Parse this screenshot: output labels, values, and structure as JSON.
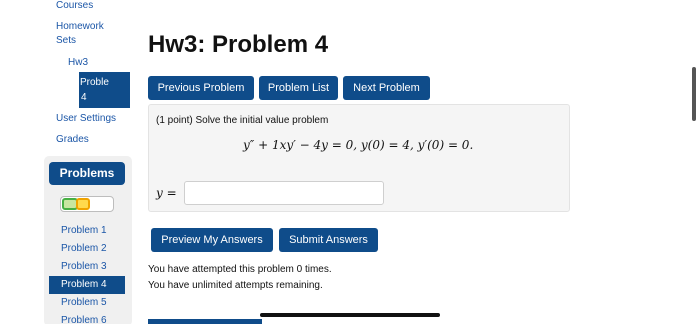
{
  "nav": {
    "courses": "Courses",
    "homework_sets": "Homework Sets",
    "set": "Hw3",
    "problem_line1": "Proble",
    "problem_line2": "4",
    "user_settings": "User Settings",
    "grades": "Grades"
  },
  "problems_panel": {
    "title": "Problems",
    "progress": {
      "correct_fraction": 0.25,
      "partial_fraction": 0.2
    },
    "items": [
      {
        "label": "Problem 1"
      },
      {
        "label": "Problem 2"
      },
      {
        "label": "Problem 3"
      },
      {
        "label": "Problem 4"
      },
      {
        "label": "Problem 5"
      },
      {
        "label": "Problem 6"
      }
    ],
    "active_index": 3
  },
  "page": {
    "title": "Hw3: Problem 4"
  },
  "toolbar": {
    "prev": "Previous Problem",
    "list": "Problem List",
    "next": "Next Problem"
  },
  "problem": {
    "points": "(1 point) Solve the initial value problem",
    "equation": "y″ + 1xy′ − 4y = 0,  y(0) = 4,  y′(0) = 0.",
    "answer_label": "y =",
    "answer_value": ""
  },
  "actions": {
    "preview": "Preview My Answers",
    "submit": "Submit Answers"
  },
  "status": {
    "attempts": "You have attempted this problem 0 times.",
    "remaining": "You have unlimited attempts remaining."
  },
  "colors": {
    "primary": "#0f4c8a",
    "link": "#1b56a7",
    "progress_green": "#47b043",
    "progress_yellow": "#f0a300"
  }
}
